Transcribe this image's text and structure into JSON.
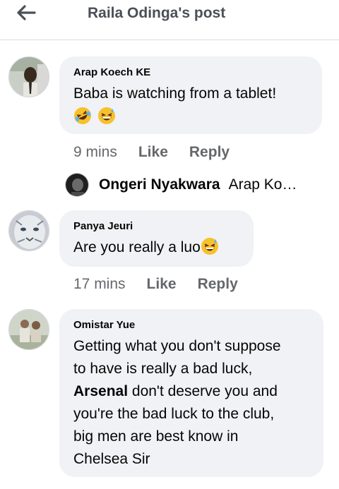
{
  "header": {
    "title": "Raila Odinga's post"
  },
  "comments": [
    {
      "author": "Arap Koech KE",
      "text": "Baba is watching from a tablet!",
      "emojis": [
        "rofl-emoji",
        "grinning-sweat-emoji"
      ],
      "time": "9 mins",
      "like": "Like",
      "reply": "Reply"
    },
    {
      "author": "Panya Jeuri",
      "text": "Are you really a luo",
      "emojis": [
        "grinning-sweat-emoji"
      ],
      "time": "17 mins",
      "like": "Like",
      "reply": "Reply"
    },
    {
      "author": "Omistar Yue",
      "text_lines": [
        "Getting what you don't suppose",
        "to have is really a bad luck,",
        "don't deserve you and",
        "you're the bad luck to the club,",
        "big men are best know in",
        "Chelsea Sir"
      ],
      "bold_word": "Arsenal"
    }
  ],
  "reply_preview": {
    "name": "Ongeri Nyakwara",
    "text": "Arap Ko…"
  },
  "colors": {
    "bubble": "#f0f2f5",
    "meta": "#65676b",
    "text": "#050505"
  }
}
